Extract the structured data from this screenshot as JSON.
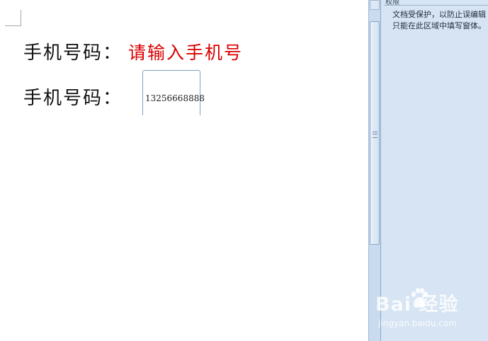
{
  "document": {
    "line1": {
      "label": "手机号码：",
      "placeholder": "请输入手机号"
    },
    "line2": {
      "label": "手机号码：",
      "value": "13256668888"
    }
  },
  "task_pane": {
    "header": "权限",
    "line1": "文档受保护，以防止误编辑",
    "line2": "只能在此区域中填写窗体。"
  },
  "watermark": {
    "logo": "Bai  经验",
    "url": "jingyan.baidu.com"
  },
  "colors": {
    "placeholder": "#d90000",
    "pane_bg": "#d6e4f3",
    "scrollbar_bg": "#c9dbef"
  }
}
